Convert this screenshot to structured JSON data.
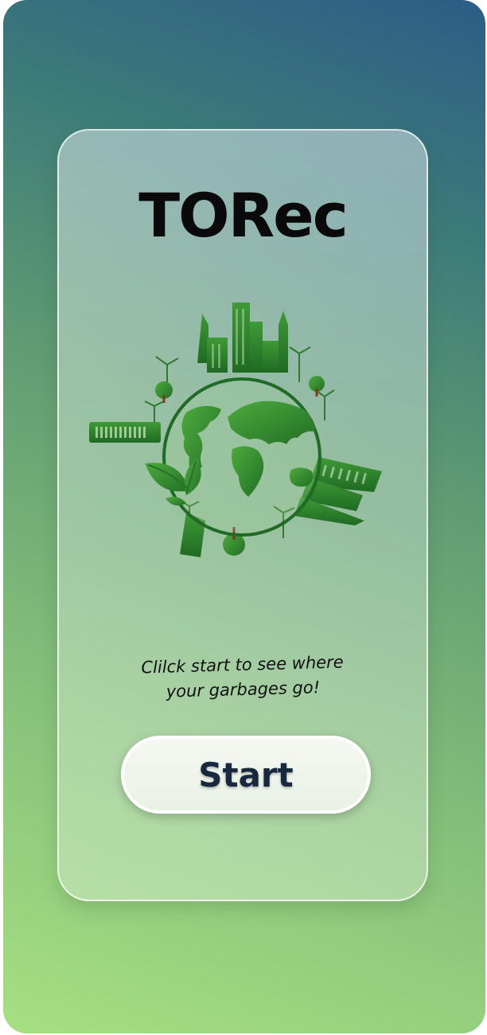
{
  "app": {
    "title": "TORec"
  },
  "main": {
    "illustration_icon": "eco-city-globe-icon",
    "tagline_line1": "Clilck start to see where",
    "tagline_line2": "your garbages go!",
    "start_label": "Start"
  },
  "colors": {
    "background_top": "#2c5d86",
    "background_bottom": "#a6df82",
    "illustration_green": "#2f8a2f",
    "button_text": "#17283f"
  }
}
